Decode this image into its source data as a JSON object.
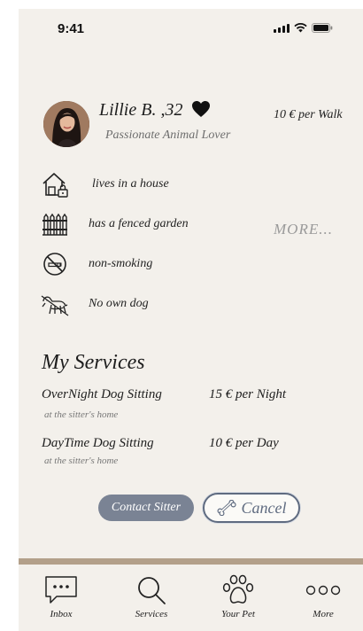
{
  "status_bar": {
    "time": "9:41"
  },
  "profile": {
    "name": "Lillie B. ,32",
    "tagline": "Passionate Animal Lover",
    "price": "10 € per Walk"
  },
  "features": [
    {
      "label": "lives in a house",
      "icon": "house-lock-icon"
    },
    {
      "label": "has a fenced garden",
      "icon": "fence-icon"
    },
    {
      "label": "non-smoking",
      "icon": "no-smoking-icon"
    },
    {
      "label": "No own dog",
      "icon": "no-dog-icon"
    }
  ],
  "more_label": "MORE...",
  "services": {
    "title": "My Services",
    "items": [
      {
        "name": "OverNight Dog Sitting",
        "sub": "at the sitter's home",
        "price": "15 € per Night"
      },
      {
        "name": "DayTime Dog Sitting",
        "sub": "at the sitter's home",
        "price": "10 € per Day"
      }
    ]
  },
  "actions": {
    "contact": "Contact Sitter",
    "cancel": "Cancel"
  },
  "tabs": [
    {
      "label": "Inbox",
      "icon": "inbox-chat-icon"
    },
    {
      "label": "Services",
      "icon": "search-icon"
    },
    {
      "label": "Your Pet",
      "icon": "paw-icon"
    },
    {
      "label": "More",
      "icon": "more-dots-icon"
    }
  ],
  "colors": {
    "background": "#f3f0eb",
    "accent": "#7a8394",
    "divider": "#b3a08a"
  }
}
